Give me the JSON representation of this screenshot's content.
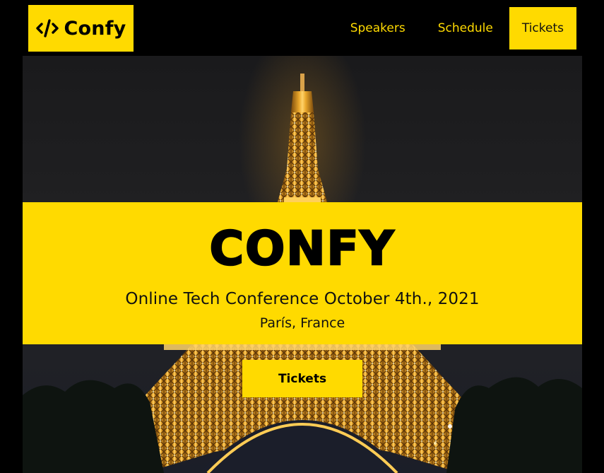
{
  "brand": {
    "logo_text": "Confy",
    "logo_icon": "code-icon",
    "accent_color": "#ffda00",
    "background_color": "#000000"
  },
  "nav": {
    "items": [
      {
        "label": "Speakers"
      },
      {
        "label": "Schedule"
      },
      {
        "label": "Tickets",
        "active": true
      }
    ]
  },
  "hero": {
    "image": "eiffel-tower-night-photo",
    "title": "CONFY",
    "subtitle": "Online Tech Conference October 4th., 2021",
    "location": "París, France",
    "cta_label": "Tickets"
  }
}
